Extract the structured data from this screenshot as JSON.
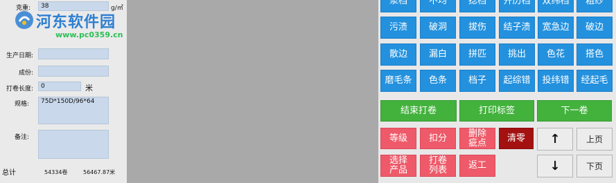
{
  "form": {
    "weight_label": "克重:",
    "weight_value": "38",
    "weight_unit": "g/㎡",
    "prod_date_label": "生产日期:",
    "prod_date_value": "",
    "composition_label": "成份:",
    "composition_value": "",
    "roll_length_label": "打卷长度:",
    "roll_length_value": "0",
    "roll_length_unit": "米",
    "spec_label": "规格:",
    "spec_value": "75D*150D/96*64",
    "note_label": "备注:",
    "note_value": ""
  },
  "totals": {
    "label": "总计",
    "rolls": "54334卷",
    "meters": "56467.87米"
  },
  "watermark": {
    "title": "河东软件园",
    "url": "www.pc0359.cn"
  },
  "defects": {
    "row0": [
      "浆档",
      "不均",
      "捻档",
      "开历档",
      "双纬档",
      "粗纱"
    ],
    "row1": [
      "污渍",
      "破洞",
      "拔伤",
      "结子渍",
      "宽急边",
      "破边"
    ],
    "row2": [
      "散边",
      "漏白",
      "拼匹",
      "挑出",
      "色花",
      "搭色"
    ],
    "row3": [
      "磨毛条",
      "色条",
      "档子",
      "起综错",
      "投纬错",
      "经起毛"
    ]
  },
  "actions": {
    "end_roll": "结束打卷",
    "print_label": "打印标签",
    "next_roll": "下一卷",
    "grade": "等级",
    "deduct": "扣分",
    "delete_defect": "删除疵点",
    "clear": "清零",
    "select_product": "选择产品",
    "roll_list": "打卷列表",
    "rework": "返工",
    "prev_page": "上页",
    "next_page": "下页",
    "up_arrow": "↑",
    "down_arrow": "↓"
  }
}
